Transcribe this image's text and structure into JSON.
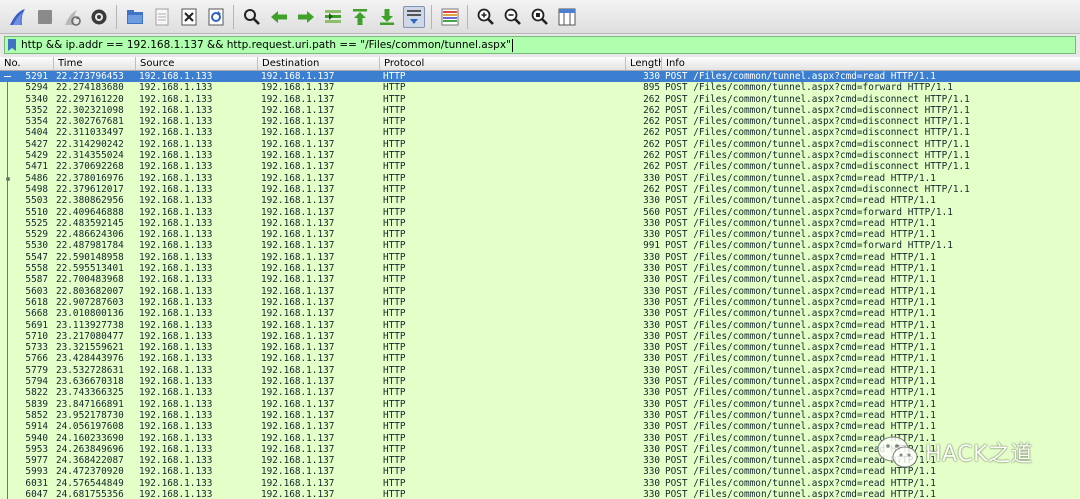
{
  "toolbar": {
    "icons": [
      "shark-fin-start-icon",
      "stop-capture-icon",
      "restart-capture-icon",
      "capture-options-icon",
      "open-file-icon",
      "save-file-icon",
      "close-file-icon",
      "reload-file-icon",
      "find-packet-icon",
      "go-back-icon",
      "go-forward-icon",
      "go-to-packet-icon",
      "go-first-icon",
      "go-last-icon",
      "autoscroll-icon",
      "colorize-icon",
      "zoom-in-icon",
      "zoom-out-icon",
      "zoom-normal-icon",
      "resize-columns-icon"
    ]
  },
  "filter": {
    "value": "http && ip.addr == 192.168.1.137 && http.request.uri.path == \"/Files/common/tunnel.aspx\""
  },
  "columns": {
    "no": "No.",
    "time": "Time",
    "source": "Source",
    "destination": "Destination",
    "protocol": "Protocol",
    "length": "Length",
    "info": "Info"
  },
  "packets": [
    {
      "no": "5291",
      "time": "22.273796453",
      "src": "192.168.1.133",
      "dst": "192.168.1.137",
      "proto": "HTTP",
      "len": "330",
      "info": "POST /Files/common/tunnel.aspx?cmd=read HTTP/1.1"
    },
    {
      "no": "5294",
      "time": "22.274183680",
      "src": "192.168.1.133",
      "dst": "192.168.1.137",
      "proto": "HTTP",
      "len": "895",
      "info": "POST /Files/common/tunnel.aspx?cmd=forward HTTP/1.1"
    },
    {
      "no": "5340",
      "time": "22.297161220",
      "src": "192.168.1.133",
      "dst": "192.168.1.137",
      "proto": "HTTP",
      "len": "262",
      "info": "POST /Files/common/tunnel.aspx?cmd=disconnect HTTP/1.1"
    },
    {
      "no": "5352",
      "time": "22.302321098",
      "src": "192.168.1.133",
      "dst": "192.168.1.137",
      "proto": "HTTP",
      "len": "262",
      "info": "POST /Files/common/tunnel.aspx?cmd=disconnect HTTP/1.1"
    },
    {
      "no": "5354",
      "time": "22.302767681",
      "src": "192.168.1.133",
      "dst": "192.168.1.137",
      "proto": "HTTP",
      "len": "262",
      "info": "POST /Files/common/tunnel.aspx?cmd=disconnect HTTP/1.1"
    },
    {
      "no": "5404",
      "time": "22.311033497",
      "src": "192.168.1.133",
      "dst": "192.168.1.137",
      "proto": "HTTP",
      "len": "262",
      "info": "POST /Files/common/tunnel.aspx?cmd=disconnect HTTP/1.1"
    },
    {
      "no": "5427",
      "time": "22.314290242",
      "src": "192.168.1.133",
      "dst": "192.168.1.137",
      "proto": "HTTP",
      "len": "262",
      "info": "POST /Files/common/tunnel.aspx?cmd=disconnect HTTP/1.1"
    },
    {
      "no": "5429",
      "time": "22.314355024",
      "src": "192.168.1.133",
      "dst": "192.168.1.137",
      "proto": "HTTP",
      "len": "262",
      "info": "POST /Files/common/tunnel.aspx?cmd=disconnect HTTP/1.1"
    },
    {
      "no": "5471",
      "time": "22.370692268",
      "src": "192.168.1.133",
      "dst": "192.168.1.137",
      "proto": "HTTP",
      "len": "262",
      "info": "POST /Files/common/tunnel.aspx?cmd=disconnect HTTP/1.1"
    },
    {
      "no": "5486",
      "time": "22.378016976",
      "src": "192.168.1.133",
      "dst": "192.168.1.137",
      "proto": "HTTP",
      "len": "330",
      "info": "POST /Files/common/tunnel.aspx?cmd=read HTTP/1.1"
    },
    {
      "no": "5498",
      "time": "22.379612017",
      "src": "192.168.1.133",
      "dst": "192.168.1.137",
      "proto": "HTTP",
      "len": "262",
      "info": "POST /Files/common/tunnel.aspx?cmd=disconnect HTTP/1.1"
    },
    {
      "no": "5503",
      "time": "22.380862956",
      "src": "192.168.1.133",
      "dst": "192.168.1.137",
      "proto": "HTTP",
      "len": "330",
      "info": "POST /Files/common/tunnel.aspx?cmd=read HTTP/1.1"
    },
    {
      "no": "5510",
      "time": "22.409646888",
      "src": "192.168.1.133",
      "dst": "192.168.1.137",
      "proto": "HTTP",
      "len": "560",
      "info": "POST /Files/common/tunnel.aspx?cmd=forward HTTP/1.1"
    },
    {
      "no": "5525",
      "time": "22.483592145",
      "src": "192.168.1.133",
      "dst": "192.168.1.137",
      "proto": "HTTP",
      "len": "330",
      "info": "POST /Files/common/tunnel.aspx?cmd=read HTTP/1.1"
    },
    {
      "no": "5529",
      "time": "22.486624306",
      "src": "192.168.1.133",
      "dst": "192.168.1.137",
      "proto": "HTTP",
      "len": "330",
      "info": "POST /Files/common/tunnel.aspx?cmd=read HTTP/1.1"
    },
    {
      "no": "5530",
      "time": "22.487981784",
      "src": "192.168.1.133",
      "dst": "192.168.1.137",
      "proto": "HTTP",
      "len": "991",
      "info": "POST /Files/common/tunnel.aspx?cmd=forward HTTP/1.1"
    },
    {
      "no": "5547",
      "time": "22.590148958",
      "src": "192.168.1.133",
      "dst": "192.168.1.137",
      "proto": "HTTP",
      "len": "330",
      "info": "POST /Files/common/tunnel.aspx?cmd=read HTTP/1.1"
    },
    {
      "no": "5558",
      "time": "22.595513401",
      "src": "192.168.1.133",
      "dst": "192.168.1.137",
      "proto": "HTTP",
      "len": "330",
      "info": "POST /Files/common/tunnel.aspx?cmd=read HTTP/1.1"
    },
    {
      "no": "5587",
      "time": "22.700483968",
      "src": "192.168.1.133",
      "dst": "192.168.1.137",
      "proto": "HTTP",
      "len": "330",
      "info": "POST /Files/common/tunnel.aspx?cmd=read HTTP/1.1"
    },
    {
      "no": "5603",
      "time": "22.803682007",
      "src": "192.168.1.133",
      "dst": "192.168.1.137",
      "proto": "HTTP",
      "len": "330",
      "info": "POST /Files/common/tunnel.aspx?cmd=read HTTP/1.1"
    },
    {
      "no": "5618",
      "time": "22.907287603",
      "src": "192.168.1.133",
      "dst": "192.168.1.137",
      "proto": "HTTP",
      "len": "330",
      "info": "POST /Files/common/tunnel.aspx?cmd=read HTTP/1.1"
    },
    {
      "no": "5668",
      "time": "23.010800136",
      "src": "192.168.1.133",
      "dst": "192.168.1.137",
      "proto": "HTTP",
      "len": "330",
      "info": "POST /Files/common/tunnel.aspx?cmd=read HTTP/1.1"
    },
    {
      "no": "5691",
      "time": "23.113927738",
      "src": "192.168.1.133",
      "dst": "192.168.1.137",
      "proto": "HTTP",
      "len": "330",
      "info": "POST /Files/common/tunnel.aspx?cmd=read HTTP/1.1"
    },
    {
      "no": "5710",
      "time": "23.217080477",
      "src": "192.168.1.133",
      "dst": "192.168.1.137",
      "proto": "HTTP",
      "len": "330",
      "info": "POST /Files/common/tunnel.aspx?cmd=read HTTP/1.1"
    },
    {
      "no": "5733",
      "time": "23.321559621",
      "src": "192.168.1.133",
      "dst": "192.168.1.137",
      "proto": "HTTP",
      "len": "330",
      "info": "POST /Files/common/tunnel.aspx?cmd=read HTTP/1.1"
    },
    {
      "no": "5766",
      "time": "23.428443976",
      "src": "192.168.1.133",
      "dst": "192.168.1.137",
      "proto": "HTTP",
      "len": "330",
      "info": "POST /Files/common/tunnel.aspx?cmd=read HTTP/1.1"
    },
    {
      "no": "5779",
      "time": "23.532728631",
      "src": "192.168.1.133",
      "dst": "192.168.1.137",
      "proto": "HTTP",
      "len": "330",
      "info": "POST /Files/common/tunnel.aspx?cmd=read HTTP/1.1"
    },
    {
      "no": "5794",
      "time": "23.636670318",
      "src": "192.168.1.133",
      "dst": "192.168.1.137",
      "proto": "HTTP",
      "len": "330",
      "info": "POST /Files/common/tunnel.aspx?cmd=read HTTP/1.1"
    },
    {
      "no": "5822",
      "time": "23.743366325",
      "src": "192.168.1.133",
      "dst": "192.168.1.137",
      "proto": "HTTP",
      "len": "330",
      "info": "POST /Files/common/tunnel.aspx?cmd=read HTTP/1.1"
    },
    {
      "no": "5839",
      "time": "23.847166891",
      "src": "192.168.1.133",
      "dst": "192.168.1.137",
      "proto": "HTTP",
      "len": "330",
      "info": "POST /Files/common/tunnel.aspx?cmd=read HTTP/1.1"
    },
    {
      "no": "5852",
      "time": "23.952178730",
      "src": "192.168.1.133",
      "dst": "192.168.1.137",
      "proto": "HTTP",
      "len": "330",
      "info": "POST /Files/common/tunnel.aspx?cmd=read HTTP/1.1"
    },
    {
      "no": "5914",
      "time": "24.056197608",
      "src": "192.168.1.133",
      "dst": "192.168.1.137",
      "proto": "HTTP",
      "len": "330",
      "info": "POST /Files/common/tunnel.aspx?cmd=read HTTP/1.1"
    },
    {
      "no": "5940",
      "time": "24.160233690",
      "src": "192.168.1.133",
      "dst": "192.168.1.137",
      "proto": "HTTP",
      "len": "330",
      "info": "POST /Files/common/tunnel.aspx?cmd=read HTTP/1.1"
    },
    {
      "no": "5953",
      "time": "24.263849696",
      "src": "192.168.1.133",
      "dst": "192.168.1.137",
      "proto": "HTTP",
      "len": "330",
      "info": "POST /Files/common/tunnel.aspx?cmd=read HTTP/1.1"
    },
    {
      "no": "5977",
      "time": "24.368422087",
      "src": "192.168.1.133",
      "dst": "192.168.1.137",
      "proto": "HTTP",
      "len": "330",
      "info": "POST /Files/common/tunnel.aspx?cmd=read HTTP/1.1"
    },
    {
      "no": "5993",
      "time": "24.472370920",
      "src": "192.168.1.133",
      "dst": "192.168.1.137",
      "proto": "HTTP",
      "len": "330",
      "info": "POST /Files/common/tunnel.aspx?cmd=read HTTP/1.1"
    },
    {
      "no": "6031",
      "time": "24.576544849",
      "src": "192.168.1.133",
      "dst": "192.168.1.137",
      "proto": "HTTP",
      "len": "330",
      "info": "POST /Files/common/tunnel.aspx?cmd=read HTTP/1.1"
    },
    {
      "no": "6047",
      "time": "24.681755356",
      "src": "192.168.1.133",
      "dst": "192.168.1.137",
      "proto": "HTTP",
      "len": "330",
      "info": "POST /Files/common/tunnel.aspx?cmd=read HTTP/1.1"
    }
  ],
  "selected_index": 0,
  "colors": {
    "row_bg": "#e4ffc7",
    "row_text": "#12272e",
    "selected_bg": "#3c7fd1",
    "filter_bg": "#afffaf"
  },
  "watermark": {
    "text": "HACK之道",
    "logo_icon": "wechat-logo-icon"
  }
}
